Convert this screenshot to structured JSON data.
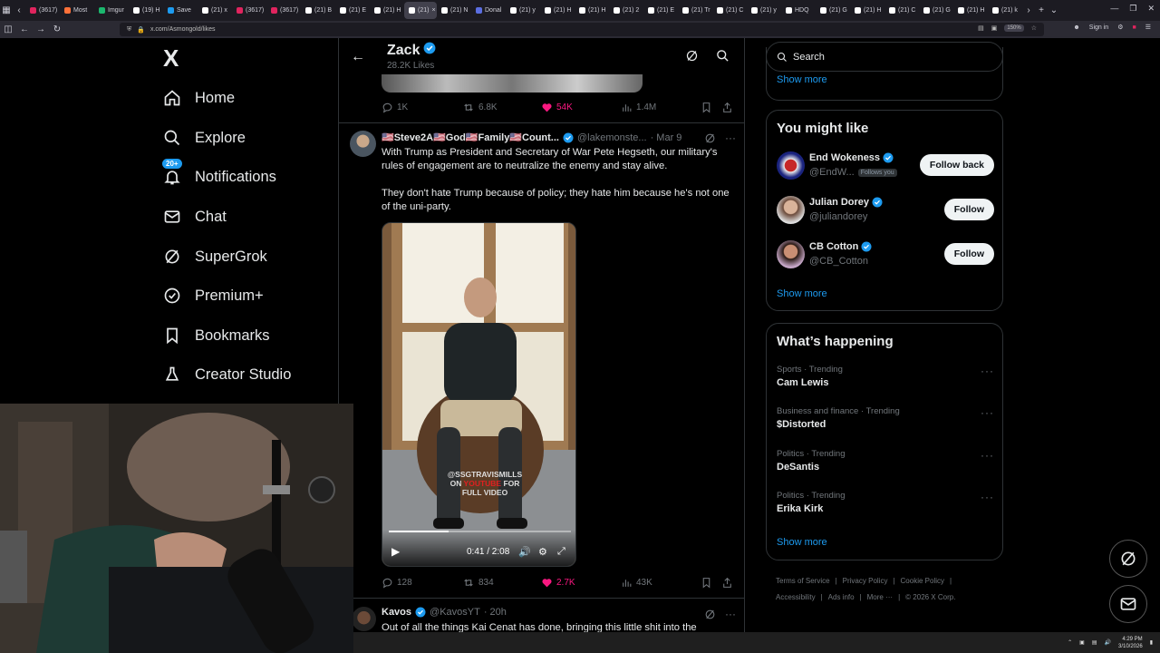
{
  "browser": {
    "tabs": [
      {
        "label": "(3617)",
        "color": "#e0245e"
      },
      {
        "label": "Most",
        "color": "#ff7139"
      },
      {
        "label": "Imgur",
        "color": "#1bb76e"
      },
      {
        "label": "(19) H",
        "color": "#ffffff"
      },
      {
        "label": "Save",
        "color": "#1d9bf0"
      },
      {
        "label": "(21) x",
        "color": "#ffffff"
      },
      {
        "label": "(3617)",
        "color": "#e0245e"
      },
      {
        "label": "(3617)",
        "color": "#e0245e"
      },
      {
        "label": "(21) B",
        "color": "#ffffff"
      },
      {
        "label": "(21) E",
        "color": "#ffffff"
      },
      {
        "label": "(21) H",
        "color": "#ffffff"
      },
      {
        "label": "(21)",
        "color": "#ffffff",
        "active": true
      },
      {
        "label": "(21) N",
        "color": "#ffffff"
      },
      {
        "label": "Donal",
        "color": "#5b6ee1"
      },
      {
        "label": "(21) y",
        "color": "#ffffff"
      },
      {
        "label": "(21) H",
        "color": "#ffffff"
      },
      {
        "label": "(21) H",
        "color": "#ffffff"
      },
      {
        "label": "(21) 2",
        "color": "#ffffff"
      },
      {
        "label": "(21) E",
        "color": "#ffffff"
      },
      {
        "label": "(21) Tr",
        "color": "#ffffff"
      },
      {
        "label": "(21) C",
        "color": "#ffffff"
      },
      {
        "label": "(21) y",
        "color": "#ffffff"
      },
      {
        "label": "HDQ",
        "color": "#ffffff"
      },
      {
        "label": "(21) G",
        "color": "#ffffff"
      },
      {
        "label": "(21) H",
        "color": "#ffffff"
      },
      {
        "label": "(21) C",
        "color": "#ffffff"
      },
      {
        "label": "(21) G",
        "color": "#ffffff"
      },
      {
        "label": "(21) H",
        "color": "#ffffff"
      },
      {
        "label": "(21) k",
        "color": "#ffffff"
      }
    ],
    "url": "x.com/Asmongold/likes",
    "zoom": "150%",
    "sign_in": "Sign in"
  },
  "leftnav": {
    "logo": "X",
    "items": [
      {
        "label": "Home",
        "icon": "home-icon"
      },
      {
        "label": "Explore",
        "icon": "search-icon"
      },
      {
        "label": "Notifications",
        "icon": "bell-icon",
        "badge": "20+"
      },
      {
        "label": "Chat",
        "icon": "mail-icon"
      },
      {
        "label": "SuperGrok",
        "icon": "grok-icon"
      },
      {
        "label": "Premium+",
        "icon": "verified-icon"
      },
      {
        "label": "Bookmarks",
        "icon": "bookmark-icon"
      },
      {
        "label": "Creator Studio",
        "icon": "creator-icon"
      }
    ]
  },
  "header": {
    "title": "Zack",
    "subtitle": "28.2K Likes"
  },
  "prev_tweet": {
    "replies": "1K",
    "reposts": "6.8K",
    "likes": "54K",
    "views": "1.4M"
  },
  "tweet1": {
    "name": "🇺🇸Steve2A🇺🇸God🇺🇸Family🇺🇸Count...",
    "handle": "@lakemonste...",
    "date": "· Mar 9",
    "text1": "With Trump as President and Secretary of War Pete Hegseth, our military's rules of engagement are to neutralize the enemy and stay alive.",
    "text2": "They don't hate Trump because of policy; they hate him because he's not one of the uni-party.",
    "video": {
      "time": "0:41 / 2:08",
      "progress": 0.33,
      "watermark_1": "@SSGTRAVISMILLS",
      "watermark_2a": "ON ",
      "watermark_2b": "YOUTUBE",
      "watermark_2c": " FOR",
      "watermark_3": "FULL VIDEO"
    },
    "replies": "128",
    "reposts": "834",
    "likes": "2.7K",
    "views": "43K"
  },
  "tweet2": {
    "name": "Kavos",
    "handle": "@KavosYT",
    "date": "· 20h",
    "text": "Out of all the things Kai Cenat has done, bringing this little shit into the"
  },
  "right": {
    "search_placeholder": "Search",
    "show_more": "Show more",
    "ymlk_title": "You might like",
    "suggestions": [
      {
        "name": "End Wokeness",
        "handle": "@EndW...",
        "follows_you": "Follows you",
        "button": "Follow back"
      },
      {
        "name": "Julian Dorey",
        "handle": "@juliandorey",
        "button": "Follow"
      },
      {
        "name": "CB Cotton",
        "handle": "@CB_Cotton",
        "button": "Follow"
      }
    ],
    "happening_title": "What’s happening",
    "trends": [
      {
        "category": "Sports · Trending",
        "title": "Cam Lewis"
      },
      {
        "category": "Business and finance · Trending",
        "title": "$Distorted"
      },
      {
        "category": "Politics · Trending",
        "title": "DeSantis"
      },
      {
        "category": "Politics · Trending",
        "title": "Erika Kirk"
      }
    ],
    "footer": {
      "terms": "Terms of Service",
      "privacy": "Privacy Policy",
      "cookie": "Cookie Policy",
      "accessibility": "Accessibility",
      "ads": "Ads info",
      "more": "More ···",
      "copyright": "© 2026 X Corp."
    }
  },
  "taskbar": {
    "time": "4:29 PM",
    "date": "3/10/2026"
  },
  "colors": {
    "accent": "#1d9bf0",
    "like": "#f91880",
    "border": "#2f3336",
    "muted": "#71767b"
  }
}
